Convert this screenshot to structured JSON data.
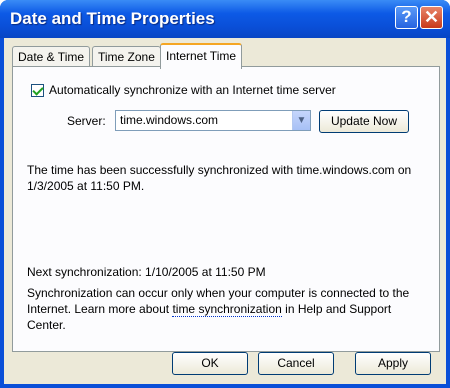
{
  "window": {
    "title": "Date and Time Properties",
    "help_glyph": "?",
    "close_glyph": "✕"
  },
  "tabs": [
    {
      "label": "Date & Time"
    },
    {
      "label": "Time Zone"
    },
    {
      "label": "Internet Time",
      "selected": true
    }
  ],
  "internet_time": {
    "auto_sync_label": "Automatically synchronize with an Internet time server",
    "auto_sync_checked": true,
    "server_label": "Server:",
    "server_value": "time.windows.com",
    "update_now_label": "Update Now",
    "status_line1": "The time has been successfully synchronized with time.windows.com on",
    "status_line2": "1/3/2005 at 11:50 PM.",
    "next_sync": "Next synchronization: 1/10/2005 at 11:50 PM",
    "info_line1": "Synchronization can occur only when your computer is connected to the",
    "info_line2_pre": "Internet.  Learn more about ",
    "info_link": "time synchronization",
    "info_line2_post": " in Help and Support",
    "info_line3": "Center."
  },
  "buttons": {
    "ok": "OK",
    "cancel": "Cancel",
    "apply": "Apply"
  },
  "colors": {
    "titlebar": "#0a4fd8",
    "dialog_bg": "#ece9d8",
    "tab_accent": "#f5a623",
    "close": "#c8391a"
  }
}
